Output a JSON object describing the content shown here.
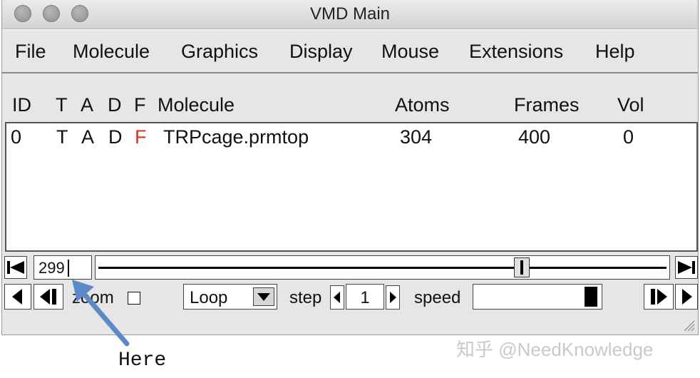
{
  "window": {
    "title": "VMD Main"
  },
  "menu": [
    "File",
    "Molecule",
    "Graphics",
    "Display",
    "Mouse",
    "Extensions",
    "Help"
  ],
  "columns": {
    "id": "ID",
    "t": "T",
    "a": "A",
    "d": "D",
    "f": "F",
    "molecule": "Molecule",
    "atoms": "Atoms",
    "frames": "Frames",
    "vol": "Vol"
  },
  "rows": [
    {
      "id": "0",
      "t": "T",
      "a": "A",
      "d": "D",
      "f": "F",
      "molecule": "TRPcage.prmtop",
      "atoms": "304",
      "frames": "400",
      "vol": "0"
    }
  ],
  "animation": {
    "frame_value": "299",
    "zoom_label": "zoom",
    "loop_option": "Loop",
    "step_label": "step",
    "step_value": "1",
    "speed_label": "speed",
    "slider_fraction": 0.75,
    "speed_fraction": 1.0
  },
  "annotation": {
    "text": "Here",
    "arrow_color": "#5b8ac6"
  },
  "watermark": "知乎 @NeedKnowledge",
  "colors": {
    "f_active": "#e0301e",
    "window_bg": "#e6e6e6"
  }
}
